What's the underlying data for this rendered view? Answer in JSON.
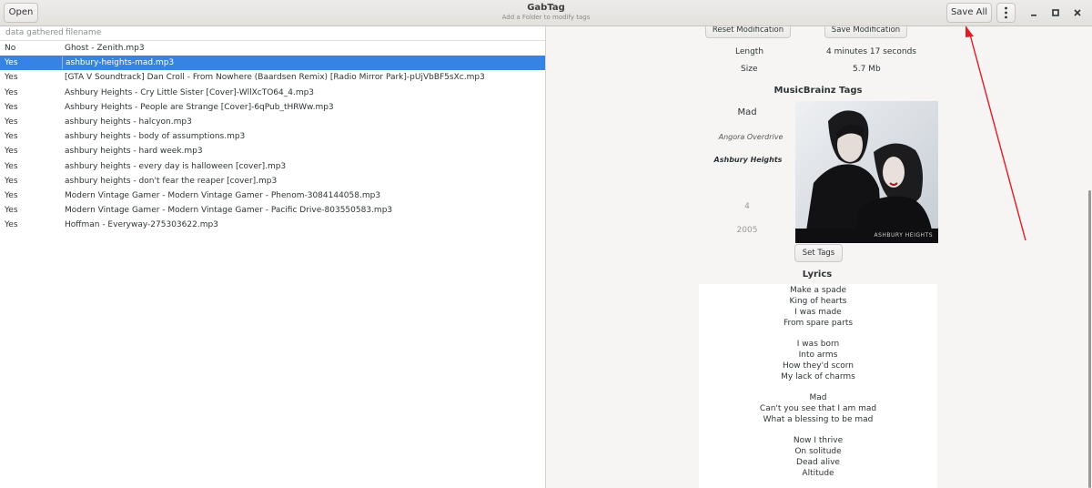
{
  "header": {
    "open_label": "Open",
    "title": "GabTag",
    "subtitle": "Add a Folder to modify tags",
    "save_all_label": "Save All",
    "menu_icon": "kebab-menu-icon",
    "minimize_icon": "minimize-icon",
    "maximize_icon": "maximize-icon",
    "close_icon": "close-icon"
  },
  "file_list": {
    "columns": [
      "data gathered",
      "filename"
    ],
    "rows": [
      {
        "gathered": "No",
        "filename": "Ghost - Zenith.mp3"
      },
      {
        "gathered": "Yes",
        "filename": "ashbury-heights-mad.mp3"
      },
      {
        "gathered": "Yes",
        "filename": "[GTA V Soundtrack] Dan Croll - From Nowhere (Baardsen Remix) [Radio Mirror Park]-pUjVbBF5sXc.mp3"
      },
      {
        "gathered": "Yes",
        "filename": "Ashbury Heights - Cry Little Sister [Cover]-WllXcTO64_4.mp3"
      },
      {
        "gathered": "Yes",
        "filename": "Ashbury Heights - People are Strange [Cover]-6qPub_tHRWw.mp3"
      },
      {
        "gathered": "Yes",
        "filename": "ashbury heights - halcyon.mp3"
      },
      {
        "gathered": "Yes",
        "filename": "ashbury heights - body of assumptions.mp3"
      },
      {
        "gathered": "Yes",
        "filename": "ashbury heights - hard week.mp3"
      },
      {
        "gathered": "Yes",
        "filename": "ashbury heights - every day is halloween [cover].mp3"
      },
      {
        "gathered": "Yes",
        "filename": "ashbury heights - don't fear the reaper [cover].mp3"
      },
      {
        "gathered": "Yes",
        "filename": "Modern Vintage Gamer - Modern Vintage Gamer - Phenom-3084144058.mp3"
      },
      {
        "gathered": "Yes",
        "filename": "Modern Vintage Gamer - Modern Vintage Gamer - Pacific Drive-803550583.mp3"
      },
      {
        "gathered": "Yes",
        "filename": "Hoffman - Everyway-275303622.mp3"
      }
    ],
    "selected_index": 1
  },
  "details": {
    "reset_label": "Reset Modification",
    "save_label": "Save Modification",
    "length_label": "Length",
    "length_value": "4 minutes 17 seconds",
    "size_label": "Size",
    "size_value": "5.7 Mb"
  },
  "musicbrainz": {
    "title": "MusicBrainz Tags",
    "song": "Mad",
    "album": "Angora Overdrive",
    "artist": "Ashbury Heights",
    "track": "4",
    "year": "2005",
    "cover_caption": "ASHBURY HEIGHTS",
    "set_tags_label": "Set Tags"
  },
  "lyrics": {
    "title": "Lyrics",
    "lines": [
      "Make a spade",
      "King of hearts",
      "I was made",
      "From spare parts",
      "",
      "I was born",
      "Into arms",
      "How they'd scorn",
      "My lack of charms",
      "",
      "Mad",
      "Can't you see that I am mad",
      "What a blessing to be mad",
      "",
      "Now I thrive",
      "On solitude",
      "Dead alive",
      "Altitude"
    ]
  },
  "colors": {
    "selection": "#3584e4",
    "annotation_arrow": "#e01b24"
  }
}
